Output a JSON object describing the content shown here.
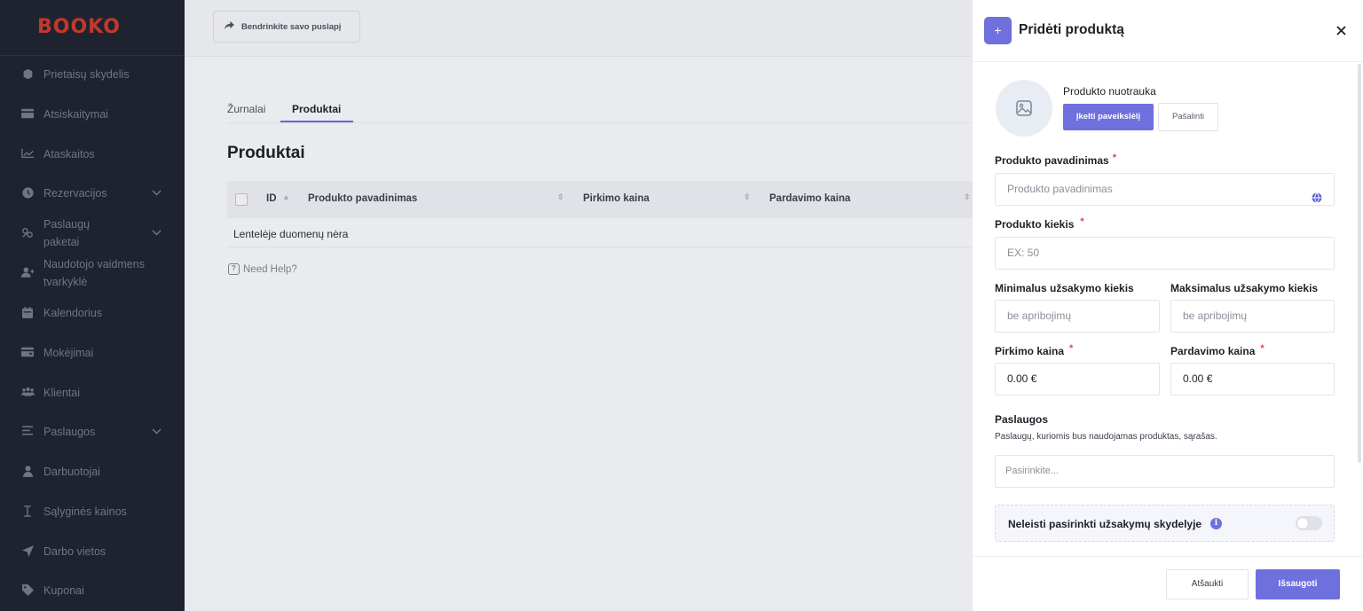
{
  "brand": {
    "logo": "BOOKO",
    "accent": "#6e70de",
    "logo_color": "#c0392b"
  },
  "sidebar": {
    "items": [
      {
        "label": "Prietaisų skydelis",
        "icon": "dashboard-icon"
      },
      {
        "label": "Atsiskaitymai",
        "icon": "credit-card-icon"
      },
      {
        "label": "Ataskaitos",
        "icon": "chart-line-icon"
      },
      {
        "label": "Rezervacijos",
        "icon": "clock-icon",
        "has_chevron": true
      },
      {
        "label": "Paslaugų paketai",
        "icon": "gift-icon",
        "has_chevron": true
      },
      {
        "label": "Naudotojo vaidmens tvarkyklė",
        "icon": "user-plus-icon"
      },
      {
        "label": "Kalendorius",
        "icon": "calendar-icon"
      },
      {
        "label": "Mokėjimai",
        "icon": "wallet-icon"
      },
      {
        "label": "Klientai",
        "icon": "users-icon"
      },
      {
        "label": "Paslaugos",
        "icon": "list-icon",
        "has_chevron": true
      },
      {
        "label": "Darbuotojai",
        "icon": "user-icon"
      },
      {
        "label": "Sąlyginės kainos",
        "icon": "text-cursor-icon"
      },
      {
        "label": "Darbo vietos",
        "icon": "location-arrow-icon"
      },
      {
        "label": "Kuponai",
        "icon": "tag-icon"
      }
    ]
  },
  "topbar": {
    "share_label": "Bendrinkite savo puslapį"
  },
  "main": {
    "tabs": [
      {
        "label": "Žurnalai"
      },
      {
        "label": "Produktai"
      }
    ],
    "title": "Produktai",
    "table": {
      "columns": [
        "ID",
        "Produkto pavadinimas",
        "Pirkimo kaina",
        "Pardavimo kaina"
      ],
      "empty_text": "Lentelėje duomenų nėra"
    },
    "need_help": "Need Help?"
  },
  "panel": {
    "title": "Pridėti produktą",
    "photo": {
      "label": "Produkto nuotrauka",
      "upload_label": "Įkelti paveikslėlį",
      "remove_label": "Pašalinti"
    },
    "name": {
      "label": "Produkto pavadinimas",
      "placeholder": "Produkto pavadinimas"
    },
    "quantity": {
      "label": "Produkto kiekis",
      "placeholder": "EX: 50"
    },
    "min_order": {
      "label": "Minimalus užsakymo kiekis",
      "placeholder": "be apribojimų"
    },
    "max_order": {
      "label": "Maksimalus užsakymo kiekis",
      "placeholder": "be apribojimų"
    },
    "purchase_price": {
      "label": "Pirkimo kaina",
      "value": "0.00 €"
    },
    "sale_price": {
      "label": "Pardavimo kaina",
      "value": "0.00 €"
    },
    "services": {
      "label": "Paslaugos",
      "help": "Paslaugų, kuriomis bus naudojamas produktas, sąrašas.",
      "placeholder": "Pasirinkite..."
    },
    "toggle": {
      "label": "Neleisti pasirinkti užsakymų skydelyje",
      "enabled": false
    },
    "cancel_label": "Atšaukti",
    "save_label": "Išsaugoti",
    "required_mark": "*"
  }
}
